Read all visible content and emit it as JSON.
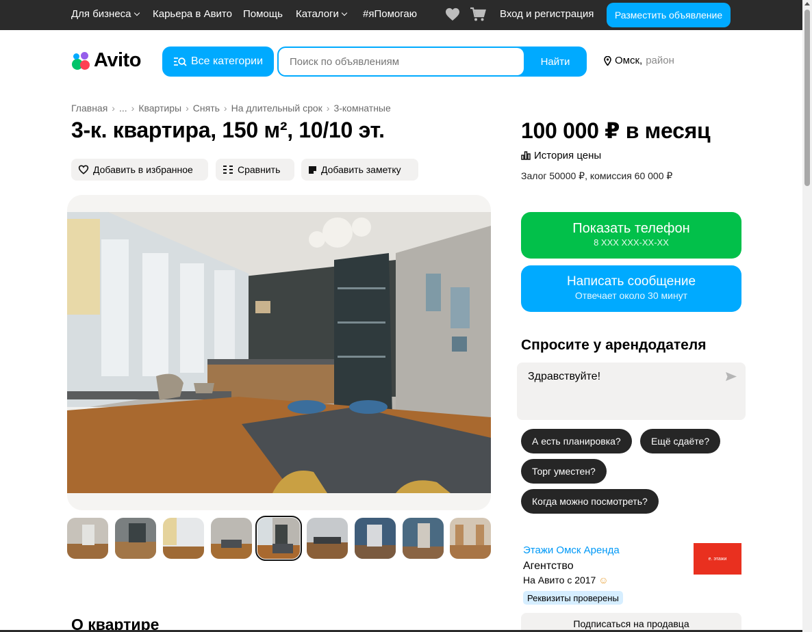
{
  "topbar": {
    "business": "Для бизнеса",
    "career": "Карьера в Авито",
    "help": "Помощь",
    "catalogs": "Каталоги",
    "ipomogayu": "#яПомогаю",
    "login": "Вход и регистрация",
    "post_ad": "Разместить объявление",
    "icons": [
      "heart-icon",
      "cart-icon"
    ]
  },
  "header": {
    "logo_text": "Avito",
    "categories_button": "Все категории",
    "search_placeholder": "Поиск по объявлениям",
    "search_button": "Найти",
    "city": "Омск,",
    "region": "район"
  },
  "breadcrumbs": [
    "Главная",
    "...",
    "Квартиры",
    "Снять",
    "На длительный срок",
    "3-комнатные"
  ],
  "listing": {
    "title": "3-к. квартира, 150 м², 10/10 эт.",
    "actions": {
      "favorite": "Добавить в избранное",
      "compare": "Сравнить",
      "note": "Добавить заметку"
    },
    "photo_count": 9,
    "active_photo_index": 4,
    "section_title": "О квартире"
  },
  "sidebar": {
    "price": "100 000 ₽ в месяц",
    "price_history": "История цены",
    "deposit": "Залог 50000 ₽, комиссия 60 000 ₽",
    "phone_button": {
      "label": "Показать телефон",
      "sub": "8 XXX XXX-XX-XX"
    },
    "message_button": {
      "label": "Написать сообщение",
      "sub": "Отвечает около 30 минут"
    },
    "ask_title": "Спросите у арендодателя",
    "ask_text": "Здравствуйте!",
    "quick_questions": [
      "А есть планировка?",
      "Ещё сдаёте?",
      "Торг уместен?",
      "Когда можно посмотреть?"
    ],
    "seller": {
      "name": "Этажи Омск Аренда",
      "type": "Агентство",
      "since": "На Авито с 2017",
      "logo_text": "e. этажи",
      "verified": "Реквизиты проверены",
      "subscribe": "Подписаться на продавца"
    }
  },
  "colors": {
    "topbar_bg": "#2b2b2b",
    "accent_blue": "#00aaff",
    "phone_green": "#02c04a",
    "chip_dark": "#262626",
    "seller_link": "#0099f7",
    "seller_logo_bg": "#e9301f"
  }
}
